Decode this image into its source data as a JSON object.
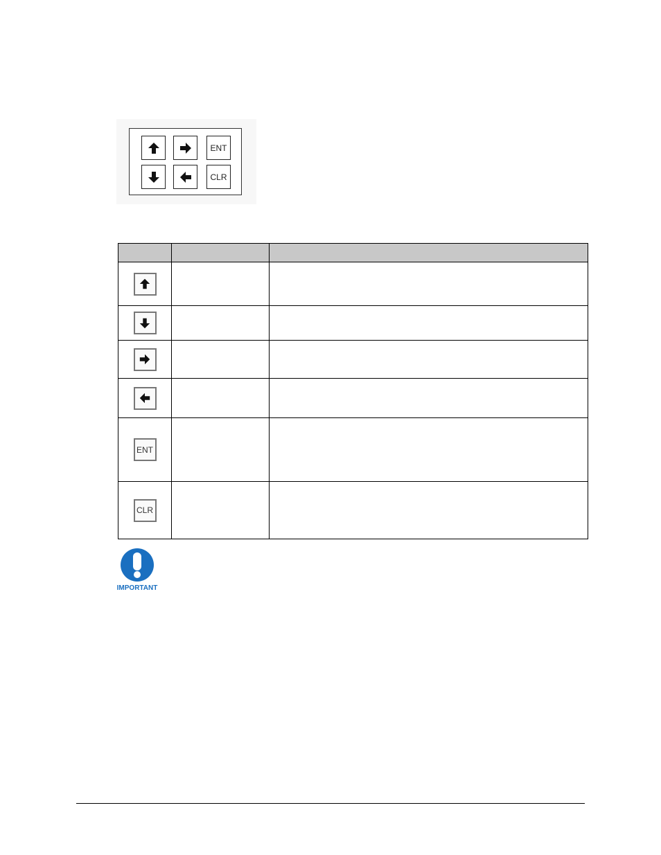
{
  "keypad_figure": {
    "keys": [
      {
        "icon": "arrow-up-icon",
        "label": ""
      },
      {
        "icon": "arrow-right-icon",
        "label": ""
      },
      {
        "icon": "",
        "label": "ENT"
      },
      {
        "icon": "arrow-down-icon",
        "label": ""
      },
      {
        "icon": "arrow-left-icon",
        "label": ""
      },
      {
        "icon": "",
        "label": "CLR"
      }
    ]
  },
  "key_table": {
    "rows": [
      {
        "icon": "arrow-up-icon",
        "label": ""
      },
      {
        "icon": "arrow-down-icon",
        "label": ""
      },
      {
        "icon": "arrow-right-icon",
        "label": ""
      },
      {
        "icon": "arrow-left-icon",
        "label": ""
      },
      {
        "icon": "",
        "label": "ENT"
      },
      {
        "icon": "",
        "label": "CLR"
      }
    ]
  },
  "important_notice": {
    "icon": "important-exclamation-icon",
    "label": "IMPORTANT",
    "color": "#1a6fc0"
  }
}
